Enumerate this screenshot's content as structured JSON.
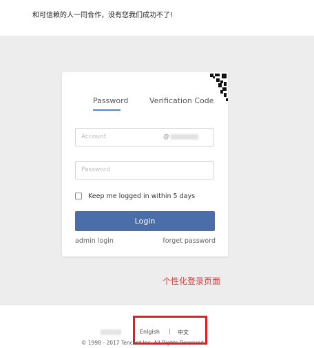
{
  "header": {
    "slogan": "和可信赖的人一同合作，没有您我们成功不了!"
  },
  "login": {
    "tabs": [
      {
        "label": "Password",
        "active": true
      },
      {
        "label": "Verification Code",
        "active": false
      }
    ],
    "account_placeholder": "Account",
    "account_suffix": "@",
    "password_placeholder": "Password",
    "keep_logged_in_label": "Keep me logged in within 5 days",
    "keep_logged_in_checked": false,
    "login_button": "Login",
    "admin_login": "admin login",
    "forget_password": "forget password"
  },
  "annotation": {
    "custom_page_note": "个性化登录页面"
  },
  "footer": {
    "lang_english": "Enlgish",
    "separator": "|",
    "lang_chinese": "中文",
    "copyright": "© 1998 - 2017 Tencent Inc. All Rights Reserved"
  },
  "colors": {
    "accent": "#4a87d4",
    "button": "#4c6ea8",
    "highlight": "#e51c23",
    "note": "#e53c3c"
  }
}
